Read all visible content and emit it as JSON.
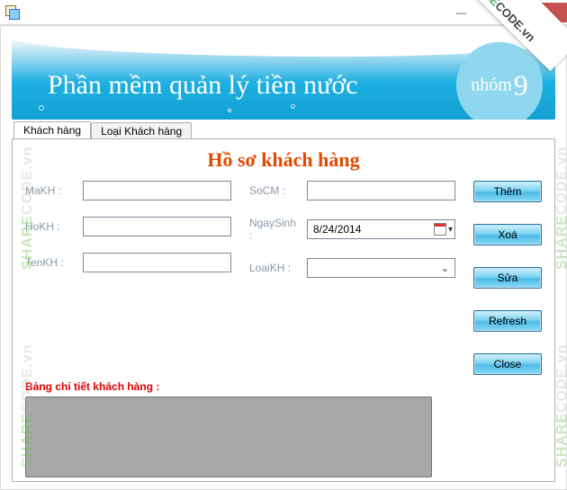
{
  "window": {
    "title": ""
  },
  "banner": {
    "title": "Phần mềm quản lý tiền nước",
    "badge_label": "nhóm",
    "badge_number": "9"
  },
  "tabs": {
    "active": "Khách hàng",
    "inactive": "Loại Khách hàng"
  },
  "form": {
    "title": "Hồ sơ khách hàng",
    "labels": {
      "makh": "MaKH :",
      "hokh": "HoKH :",
      "tenkh": "TenKH :",
      "socm": "SoCM :",
      "ngaysinh": "NgaySinh :",
      "loaikh": "LoaiKH :"
    },
    "values": {
      "makh": "",
      "hokh": "",
      "tenkh": "",
      "socm": "",
      "ngaysinh": "8/24/2014",
      "loaikh": ""
    }
  },
  "actions": {
    "them": "Thêm",
    "xoa": "Xoá",
    "sua": "Sửa",
    "refresh": "Refresh",
    "close": "Close"
  },
  "detail": {
    "label": "Bảng chi tiết khách hàng :"
  },
  "watermark": {
    "brand_share": "SHARE",
    "brand_code": "CODE",
    "brand_tld": ".vn"
  }
}
